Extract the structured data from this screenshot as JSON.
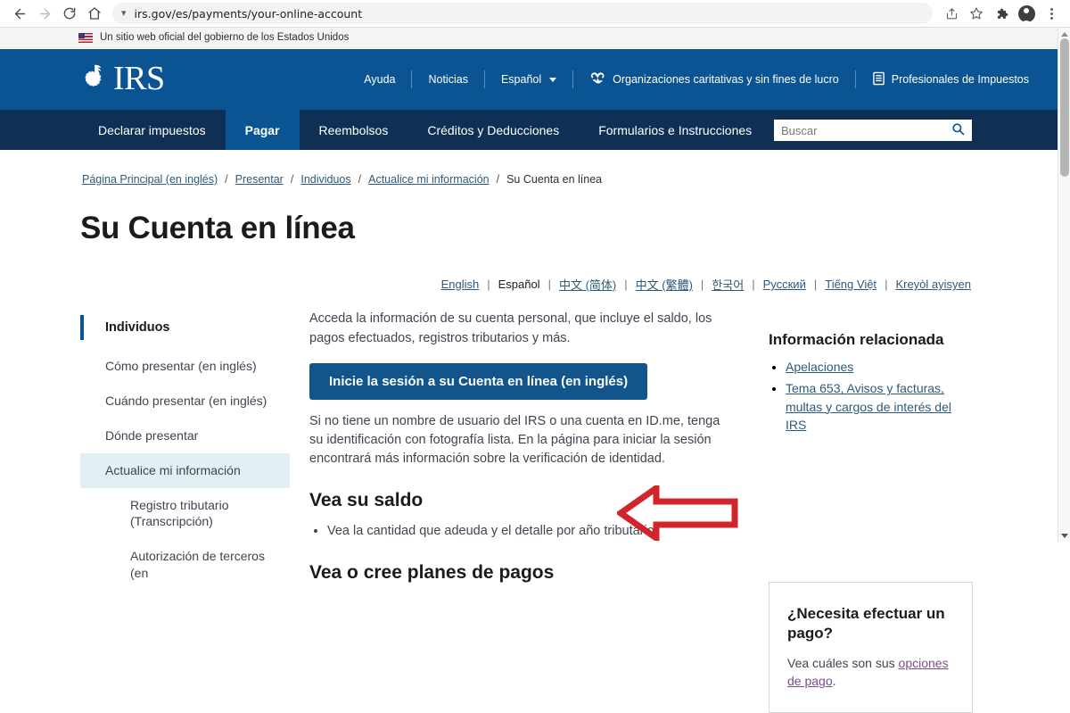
{
  "browser": {
    "url": "irs.gov/es/payments/your-online-account",
    "back_label": "back-arrow",
    "forward_label": "forward-arrow",
    "reload_label": "reload",
    "home_label": "home",
    "share_label": "share",
    "bookmark_label": "bookmark-star",
    "extensions_label": "extensions-puzzle",
    "profile_label": "profile-avatar",
    "menu_label": "browser-menu"
  },
  "gov_banner": {
    "text": "Un sitio web oficial del gobierno de los Estados Unidos"
  },
  "header": {
    "logo_text": "IRS",
    "util_links": [
      {
        "label": "Ayuda",
        "icon": ""
      },
      {
        "label": "Noticias",
        "icon": ""
      },
      {
        "label": "Español",
        "icon": "chevron-down-icon"
      },
      {
        "label": "Organizaciones caritativas y sin fines de lucro",
        "icon": "charities-icon"
      },
      {
        "label": "Profesionales de Impuestos",
        "icon": "book-icon"
      }
    ]
  },
  "main_nav": {
    "items": [
      {
        "label": "Declarar impuestos",
        "active": false
      },
      {
        "label": "Pagar",
        "active": true
      },
      {
        "label": "Reembolsos",
        "active": false
      },
      {
        "label": "Créditos y Deducciones",
        "active": false
      },
      {
        "label": "Formularios e Instrucciones",
        "active": false
      }
    ],
    "search_placeholder": "Buscar",
    "search_value": ""
  },
  "breadcrumb": {
    "items": [
      "Página Principal (en inglés)",
      "Presentar",
      "Individuos",
      "Actualice mi información"
    ],
    "current": "Su Cuenta en línea",
    "separator": "/"
  },
  "page": {
    "title": "Su Cuenta en línea"
  },
  "languages": {
    "items": [
      {
        "label": "English",
        "current": false
      },
      {
        "label": "Español",
        "current": true
      },
      {
        "label": "中文 (简体)",
        "current": false
      },
      {
        "label": "中文 (繁體)",
        "current": false
      },
      {
        "label": "한국어",
        "current": false
      },
      {
        "label": "Русский",
        "current": false
      },
      {
        "label": "Tiếng Việt",
        "current": false
      },
      {
        "label": "Kreyòl ayisyen",
        "current": false
      }
    ],
    "separator": "|"
  },
  "sidebar": {
    "heading": "Individuos",
    "items": [
      {
        "label": "Cómo presentar (en inglés)",
        "active": false,
        "sub": false
      },
      {
        "label": "Cuándo presentar (en inglés)",
        "active": false,
        "sub": false
      },
      {
        "label": "Dónde presentar",
        "active": false,
        "sub": false
      },
      {
        "label": "Actualice mi información",
        "active": true,
        "sub": false
      },
      {
        "label": "Registro tributario (Transcripción)",
        "active": false,
        "sub": true
      },
      {
        "label": "Autorización de terceros (en",
        "active": false,
        "sub": true
      }
    ]
  },
  "main": {
    "intro": "Acceda la información de su cuenta personal, que incluye el saldo, los pagos efectuados, registros tributarios y más.",
    "signin_button": "Inicie la sesión a su Cuenta en línea (en inglés)",
    "note": "Si no tiene un nombre de usuario del IRS o una cuenta en ID.me, tenga su identificación con fotografía lista. En la página para iniciar la sesión encontrará más información sobre la verificación de identidad.",
    "sections": [
      {
        "heading": "Vea su saldo",
        "bullets": [
          "Vea la cantidad que adeuda y el detalle por año tributario."
        ]
      },
      {
        "heading": "Vea o cree planes de pagos",
        "bullets": []
      }
    ]
  },
  "right_sidebar": {
    "heading": "Información relacionada",
    "links": [
      "Apelaciones",
      "Tema 653, Avisos y facturas, multas y cargos de interés del IRS"
    ],
    "callout": {
      "heading": "¿Necesita efectuar un pago?",
      "text_before": "Vea cuáles son sus ",
      "link": "opciones de pago",
      "text_after": "."
    }
  },
  "annotation": {
    "arrow": "red-left-arrow-pointing-to-signin-button",
    "color": "#d1252b"
  },
  "colors": {
    "header_blue": "#0b5493",
    "nav_blue": "#102f54",
    "button_blue": "#12558d",
    "link_blue": "#2d5a7b",
    "sidebar_active": "#e1f0f3",
    "visited_link": "#7c4d8c",
    "arrow_red": "#d1252b"
  }
}
